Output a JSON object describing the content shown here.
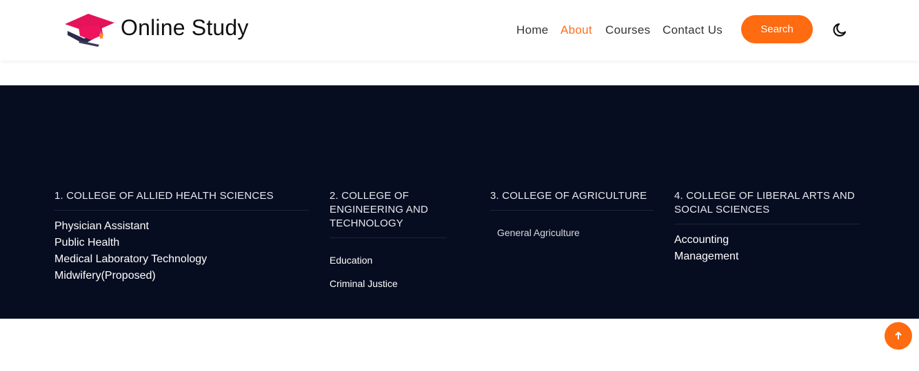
{
  "header": {
    "brand": "Online Study",
    "nav": [
      "Home",
      "About",
      "Courses",
      "Contact Us"
    ],
    "active_nav": "About",
    "search_label": "Search",
    "accent_color": "#fb6f1e",
    "logo_icon": "graduation-cap-icon",
    "theme_icon": "moon-icon"
  },
  "colleges": [
    {
      "title": "1. COLLEGE OF ALLIED HEALTH SCIENCES",
      "items": [
        "Physician Assistant",
        "Public Health",
        "Medical Laboratory Technology",
        "Midwifery(Proposed)"
      ]
    },
    {
      "title": "2. COLLEGE OF ENGINEERING AND TECHNOLOGY",
      "items": [
        "Education",
        "Criminal Justice"
      ]
    },
    {
      "title": "3. COLLEGE OF AGRICULTURE",
      "items": [
        "General Agriculture"
      ]
    },
    {
      "title": "4. COLLEGE OF LIBERAL ARTS AND SOCIAL SCIENCES",
      "items": [
        "Accounting",
        "Management"
      ]
    }
  ],
  "scroll_top_icon": "arrow-up-icon",
  "footer_bg": "#070d20"
}
